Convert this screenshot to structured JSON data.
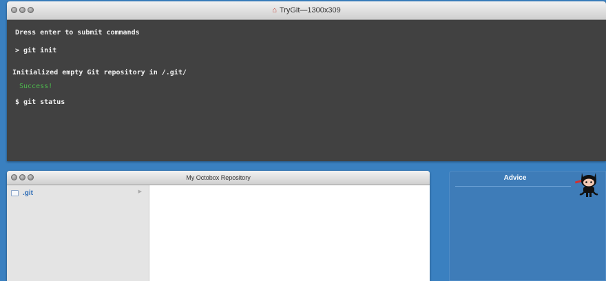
{
  "terminal": {
    "title": "TryGit—1300x309",
    "lines": [
      "Dress enter to submit commands",
      "> git init",
      "Initialized empty Git repository in /.git/",
      "Success!",
      "$ git status"
    ]
  },
  "repository": {
    "title": "My Octobox Repository",
    "files": [
      ".git"
    ]
  },
  "advice": {
    "title": "Advice"
  },
  "colors": {
    "background": "#3a80c0",
    "terminal_bg": "#414141",
    "success_text": "#4db84d",
    "file_link": "#2c6bb5"
  },
  "icons": [
    "home-icon",
    "folder-icon",
    "arrow-right-icon",
    "octocat-icon"
  ]
}
